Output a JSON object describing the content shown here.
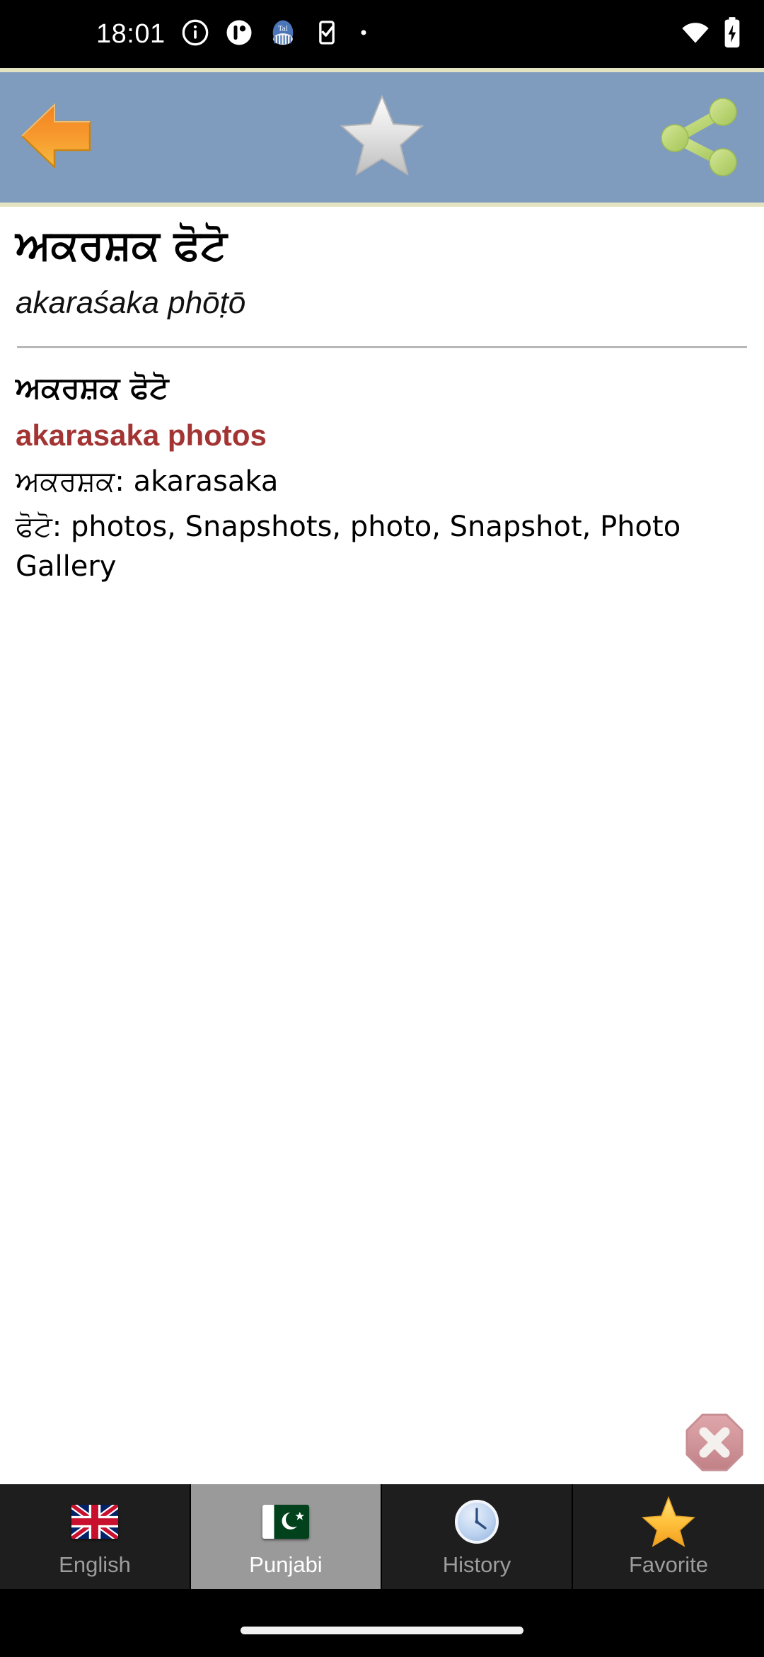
{
  "status_bar": {
    "time": "18:01",
    "left_icons": [
      "info-icon",
      "app-badge-icon",
      "blue-app-icon",
      "checkbox-icon",
      "dot-icon"
    ],
    "right_icons": [
      "wifi-icon",
      "battery-charging-icon"
    ]
  },
  "toolbar": {
    "background_color": "#7f9cbf",
    "border_color": "#e3e3c2",
    "back_label": "back-arrow-icon",
    "favorite_label": "star-icon",
    "share_label": "share-icon"
  },
  "entry": {
    "headword": "ਅਕਰਸ਼ਕ ਫੋਟੋ",
    "transliteration": "akaraśaka phōṭō",
    "definition_gurmukhi": "ਅਕਰਸ਼ਕ ਫੋਟੋ",
    "definition_title": "akarasaka photos",
    "definition_title_color": "#a33434",
    "lines": [
      "ਅਕਰਸ਼ਕ: akarasaka",
      "ਫੋਟੋ: photos, Snapshots, photo, Snapshot, Photo Gallery"
    ]
  },
  "close_button": {
    "name": "close-icon",
    "color": "#c98b90"
  },
  "bottom_nav": {
    "selected_index": 1,
    "tabs": [
      {
        "label": "English",
        "icon": "uk-flag-icon"
      },
      {
        "label": "Punjabi",
        "icon": "pakistan-flag-icon"
      },
      {
        "label": "History",
        "icon": "clock-icon"
      },
      {
        "label": "Favorite",
        "icon": "star-icon"
      }
    ]
  }
}
